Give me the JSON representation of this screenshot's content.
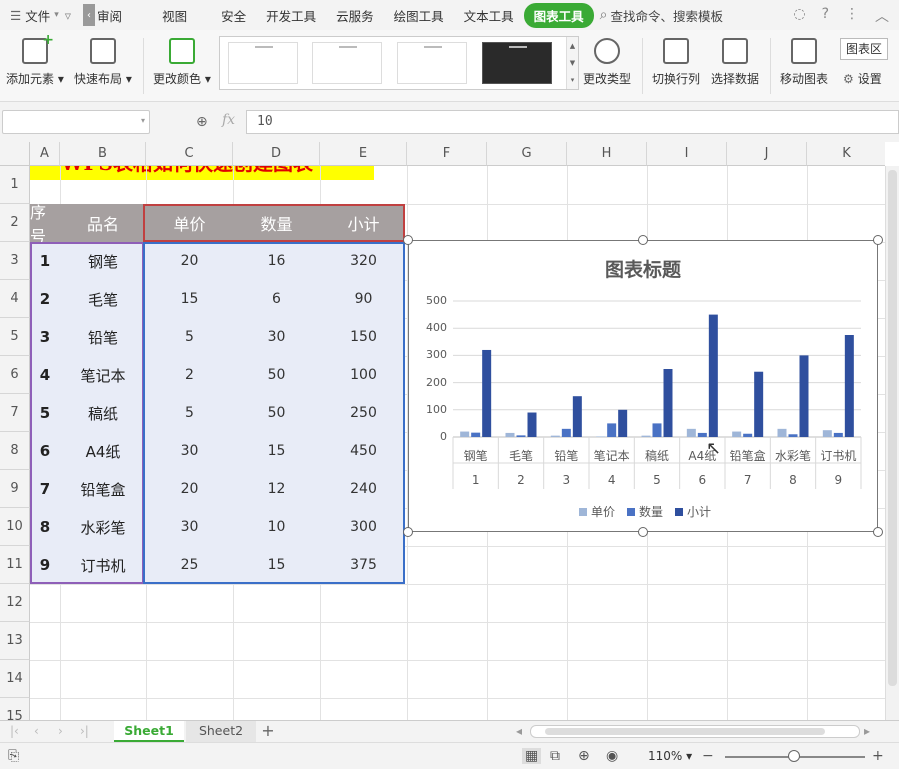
{
  "menubar": {
    "file": "文件",
    "items": [
      "审阅",
      "视图",
      "安全",
      "开发工具",
      "云服务",
      "绘图工具",
      "文本工具"
    ],
    "active_tab": "图表工具",
    "search": "查找命令、搜索模板"
  },
  "ribbon": {
    "add_element": "添加元素",
    "quick_layout": "快速布局",
    "change_color": "更改颜色",
    "change_type": "更改类型",
    "switch_row_col": "切换行列",
    "select_data": "选择数据",
    "move_chart": "移动图表",
    "chart_area": "图表区",
    "settings": "设置"
  },
  "formula_bar": {
    "name_box": "",
    "fx": "fx",
    "value": "10"
  },
  "sheet": {
    "columns": [
      "A",
      "B",
      "C",
      "D",
      "E",
      "F",
      "G",
      "H",
      "I",
      "J",
      "K"
    ],
    "rows": [
      "1",
      "2",
      "3",
      "4",
      "5",
      "6",
      "7",
      "8",
      "9",
      "10",
      "11",
      "12",
      "13",
      "14",
      "15"
    ],
    "title": "WPS表格如何快速创建图表",
    "headers": [
      "序号",
      "品名",
      "单价",
      "数量",
      "小计"
    ],
    "data": [
      [
        "1",
        "钢笔",
        "20",
        "16",
        "320"
      ],
      [
        "2",
        "毛笔",
        "15",
        "6",
        "90"
      ],
      [
        "3",
        "铅笔",
        "5",
        "30",
        "150"
      ],
      [
        "4",
        "笔记本",
        "2",
        "50",
        "100"
      ],
      [
        "5",
        "稿纸",
        "5",
        "50",
        "250"
      ],
      [
        "6",
        "A4纸",
        "30",
        "15",
        "450"
      ],
      [
        "7",
        "铅笔盒",
        "20",
        "12",
        "240"
      ],
      [
        "8",
        "水彩笔",
        "30",
        "10",
        "300"
      ],
      [
        "9",
        "订书机",
        "25",
        "15",
        "375"
      ]
    ]
  },
  "chart_data": {
    "type": "bar",
    "title": "图表标题",
    "categories": [
      "钢笔",
      "毛笔",
      "铅笔",
      "笔记本",
      "稿纸",
      "A4纸",
      "铅笔盒",
      "水彩笔",
      "订书机"
    ],
    "category_index": [
      "1",
      "2",
      "3",
      "4",
      "5",
      "6",
      "7",
      "8",
      "9"
    ],
    "series": [
      {
        "name": "单价",
        "values": [
          20,
          15,
          5,
          2,
          5,
          30,
          20,
          30,
          25
        ],
        "color": "#9fb6d8"
      },
      {
        "name": "数量",
        "values": [
          16,
          6,
          30,
          50,
          50,
          15,
          12,
          10,
          15
        ],
        "color": "#4a72c4"
      },
      {
        "name": "小计",
        "values": [
          320,
          90,
          150,
          100,
          250,
          450,
          240,
          300,
          375
        ],
        "color": "#2f4f9e"
      }
    ],
    "yticks": [
      "0",
      "100",
      "200",
      "300",
      "400",
      "500"
    ],
    "ylim": [
      0,
      500
    ],
    "grid": true,
    "legend": "bottom"
  },
  "tabs": {
    "sheet1": "Sheet1",
    "sheet2": "Sheet2",
    "add": "+"
  },
  "status": {
    "zoom": "110%"
  },
  "colors": {
    "title_bg": "#ffff00",
    "title_text": "#e00000",
    "header_bg": "#a6a0a0",
    "data_bg": "#e8ecf7",
    "active_tab": "#3aaa35"
  }
}
